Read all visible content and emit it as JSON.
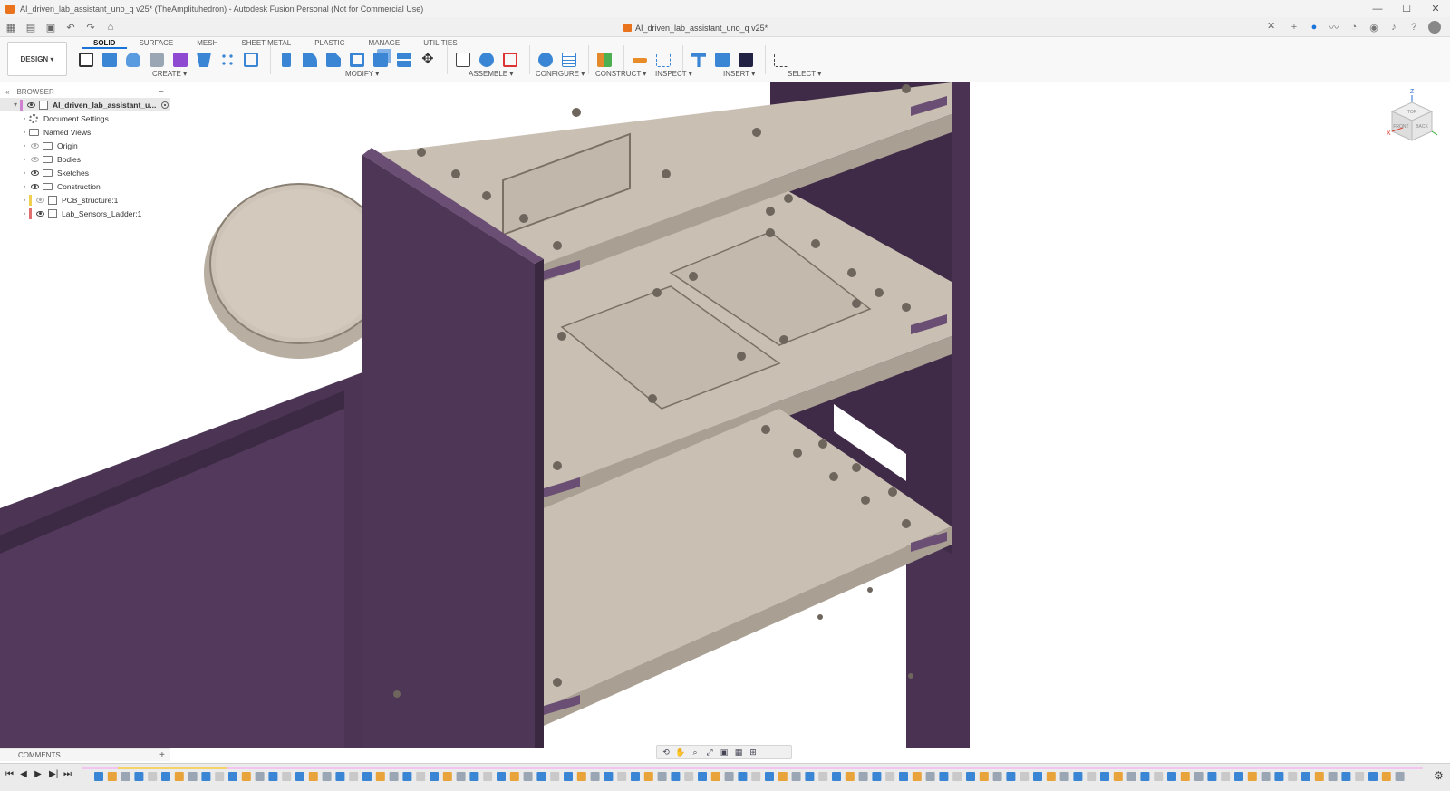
{
  "window": {
    "title": "AI_driven_lab_assistant_uno_q v25* (TheAmplituhedron) - Autodesk Fusion Personal (Not for Commercial Use)",
    "controls": {
      "minimize": "—",
      "maximize": "☐",
      "close": "✕"
    }
  },
  "doc_tab": {
    "title": "AI_driven_lab_assistant_uno_q v25*",
    "close": "✕"
  },
  "quick_access": {
    "grid": "▦",
    "file": "▤",
    "save": "▣",
    "undo": "↶",
    "redo": "↷",
    "home": "⌂",
    "new_tab": "+"
  },
  "workspace": {
    "label": "DESIGN ▾"
  },
  "tabs": [
    "SOLID",
    "SURFACE",
    "MESH",
    "SHEET METAL",
    "PLASTIC",
    "MANAGE",
    "UTILITIES"
  ],
  "active_tab": "SOLID",
  "groups": {
    "create": "CREATE ▾",
    "modify": "MODIFY ▾",
    "assemble": "ASSEMBLE ▾",
    "configure": "CONFIGURE ▾",
    "construct": "CONSTRUCT ▾",
    "inspect": "INSPECT ▾",
    "insert": "INSERT ▾",
    "select": "SELECT ▾"
  },
  "browser": {
    "header": "BROWSER",
    "collapse": "«",
    "minimize": "−",
    "root": "AI_driven_lab_assistant_u...",
    "items": [
      {
        "label": "Document Settings"
      },
      {
        "label": "Named Views"
      },
      {
        "label": "Origin"
      },
      {
        "label": "Bodies"
      },
      {
        "label": "Sketches"
      },
      {
        "label": "Construction"
      },
      {
        "label": "PCB_structure:1"
      },
      {
        "label": "Lab_Sensors_Ladder:1"
      }
    ]
  },
  "viewcube": {
    "top": "TOP",
    "front": "FRONT",
    "back": "BACK",
    "z": "Z",
    "x": "X"
  },
  "comments": {
    "label": "COMMENTS",
    "add": "+"
  },
  "navbar": {
    "orbit": "⟲",
    "pan": "✋",
    "zoom": "⌕",
    "fit": "⤢",
    "display": "▣",
    "grid": "▦",
    "viewports": "⊞"
  },
  "timeline": {
    "first": "⏮",
    "prev": "◀",
    "play": "▶",
    "next": "▶|",
    "last": "⏭",
    "settings": "⚙"
  },
  "colors": {
    "accent": "#1a73d9",
    "body_purple": "#4a3352",
    "shelf_tan": "#c9bfb3",
    "app_orange": "#e8731c"
  }
}
